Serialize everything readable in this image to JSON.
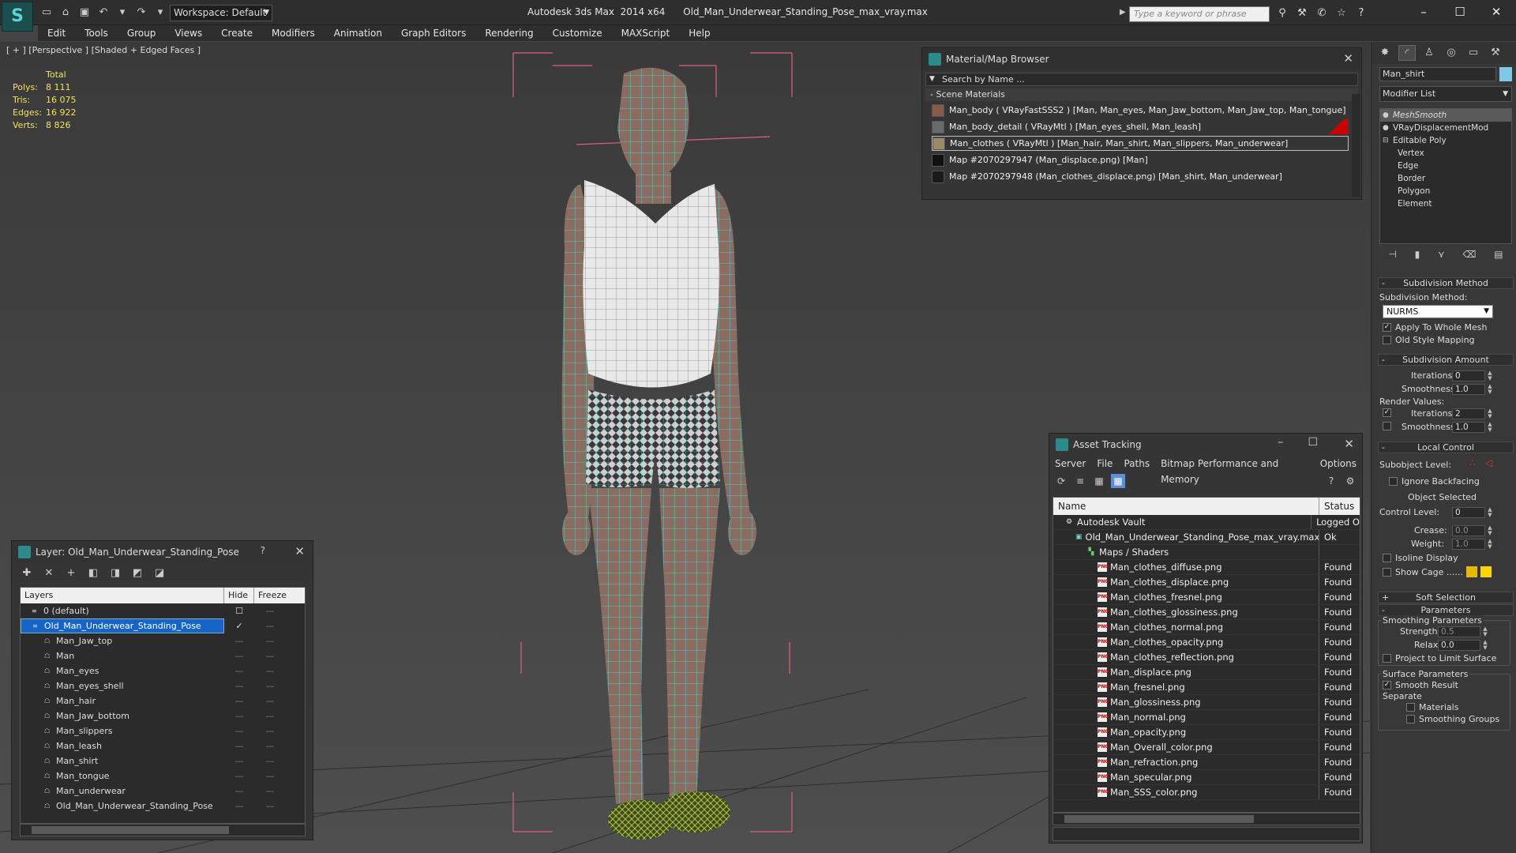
{
  "titlebar": {
    "workspace": "Workspace: Default",
    "title": "Autodesk 3ds Max  2014 x64      Old_Man_Underwear_Standing_Pose_max_vray.max",
    "search_placeholder": "Type a keyword or phrase"
  },
  "menu": [
    "Edit",
    "Tools",
    "Group",
    "Views",
    "Create",
    "Modifiers",
    "Animation",
    "Graph Editors",
    "Rendering",
    "Customize",
    "MAXScript",
    "Help"
  ],
  "viewport": {
    "label": "[ + ] [Perspective ] [Shaded + Edged Faces ]",
    "stats": {
      "header": "Total",
      "rows": [
        {
          "k": "Polys:",
          "v": "8 111"
        },
        {
          "k": "Tris:",
          "v": "16 075"
        },
        {
          "k": "Edges:",
          "v": "16 922"
        },
        {
          "k": "Verts:",
          "v": "8 826"
        }
      ]
    }
  },
  "material_browser": {
    "title": "Material/Map Browser",
    "search": "Search by Name ...",
    "section": "- Scene Materials",
    "items": [
      {
        "label": "Man_body  ( VRayFastSSS2 ) [Man, Man_eyes, Man_Jaw_bottom, Man_Jaw_top, Man_tongue]",
        "swatch": "#8a5a48"
      },
      {
        "label": "Man_body_detail  ( VRayMtl ) [Man_eyes_shell, Man_leash]",
        "swatch": "#6a6a6a"
      },
      {
        "label": "Man_clothes  ( VRayMtl ) [Man_hair, Man_shirt, Man_slippers, Man_underwear]",
        "swatch": "#9a8a6a"
      },
      {
        "label": "Map #2070297947 (Man_displace.png)  [Man]",
        "swatch": "#111111"
      },
      {
        "label": "Map #2070297948 (Man_clothes_displace.png)  [Man_shirt, Man_underwear]",
        "swatch": "#1a1a1a"
      }
    ]
  },
  "asset_tracking": {
    "title": "Asset Tracking",
    "menu": [
      "Server",
      "File",
      "Paths",
      "Bitmap Performance and Memory",
      "Options"
    ],
    "columns": {
      "name": "Name",
      "status": "Status"
    },
    "rows": [
      {
        "name": "Autodesk Vault",
        "status": "Logged O",
        "indent": 1,
        "icon": "vault"
      },
      {
        "name": "Old_Man_Underwear_Standing_Pose_max_vray.max",
        "status": "Ok",
        "indent": 2,
        "icon": "max"
      },
      {
        "name": "Maps / Shaders",
        "status": "",
        "indent": 3,
        "icon": "folder"
      },
      {
        "name": "Man_clothes_diffuse.png",
        "status": "Found",
        "indent": 4,
        "icon": "png"
      },
      {
        "name": "Man_clothes_displace.png",
        "status": "Found",
        "indent": 4,
        "icon": "png"
      },
      {
        "name": "Man_clothes_fresnel.png",
        "status": "Found",
        "indent": 4,
        "icon": "png"
      },
      {
        "name": "Man_clothes_glossiness.png",
        "status": "Found",
        "indent": 4,
        "icon": "png"
      },
      {
        "name": "Man_clothes_normal.png",
        "status": "Found",
        "indent": 4,
        "icon": "png"
      },
      {
        "name": "Man_clothes_opacity.png",
        "status": "Found",
        "indent": 4,
        "icon": "png"
      },
      {
        "name": "Man_clothes_reflection.png",
        "status": "Found",
        "indent": 4,
        "icon": "png"
      },
      {
        "name": "Man_displace.png",
        "status": "Found",
        "indent": 4,
        "icon": "png"
      },
      {
        "name": "Man_fresnel.png",
        "status": "Found",
        "indent": 4,
        "icon": "png"
      },
      {
        "name": "Man_glossiness.png",
        "status": "Found",
        "indent": 4,
        "icon": "png"
      },
      {
        "name": "Man_normal.png",
        "status": "Found",
        "indent": 4,
        "icon": "png"
      },
      {
        "name": "Man_opacity.png",
        "status": "Found",
        "indent": 4,
        "icon": "png"
      },
      {
        "name": "Man_Overall_color.png",
        "status": "Found",
        "indent": 4,
        "icon": "png"
      },
      {
        "name": "Man_refraction.png",
        "status": "Found",
        "indent": 4,
        "icon": "png"
      },
      {
        "name": "Man_specular.png",
        "status": "Found",
        "indent": 4,
        "icon": "png"
      },
      {
        "name": "Man_SSS_color.png",
        "status": "Found",
        "indent": 4,
        "icon": "png"
      }
    ]
  },
  "layers_panel": {
    "title": "Layer: Old_Man_Underwear_Standing_Pose",
    "help": "?",
    "columns": {
      "layers": "Layers",
      "hide": "Hide",
      "freeze": "Freeze"
    },
    "rows": [
      {
        "name": "0 (default)",
        "indent": 1,
        "type": "layer",
        "selected": false
      },
      {
        "name": "Old_Man_Underwear_Standing_Pose",
        "indent": 1,
        "type": "layer",
        "selected": true
      },
      {
        "name": "Man_Jaw_top",
        "indent": 2,
        "type": "obj",
        "selected": false
      },
      {
        "name": "Man",
        "indent": 2,
        "type": "obj",
        "selected": false
      },
      {
        "name": "Man_eyes",
        "indent": 2,
        "type": "obj",
        "selected": false
      },
      {
        "name": "Man_eyes_shell",
        "indent": 2,
        "type": "obj",
        "selected": false
      },
      {
        "name": "Man_hair",
        "indent": 2,
        "type": "obj",
        "selected": false
      },
      {
        "name": "Man_Jaw_bottom",
        "indent": 2,
        "type": "obj",
        "selected": false
      },
      {
        "name": "Man_slippers",
        "indent": 2,
        "type": "obj",
        "selected": false
      },
      {
        "name": "Man_leash",
        "indent": 2,
        "type": "obj",
        "selected": false
      },
      {
        "name": "Man_shirt",
        "indent": 2,
        "type": "obj",
        "selected": false
      },
      {
        "name": "Man_tongue",
        "indent": 2,
        "type": "obj",
        "selected": false
      },
      {
        "name": "Man_underwear",
        "indent": 2,
        "type": "obj",
        "selected": false
      },
      {
        "name": "Old_Man_Underwear_Standing_Pose",
        "indent": 2,
        "type": "obj",
        "selected": false
      }
    ]
  },
  "command_panel": {
    "object_name": "Man_shirt",
    "object_color": "#7ec8e8",
    "modifier_list": "Modifier List",
    "stack": [
      "MeshSmooth",
      "VRayDisplacementMod",
      "Editable Poly",
      "Vertex",
      "Edge",
      "Border",
      "Polygon",
      "Element"
    ],
    "subdivision_method": {
      "rollout": "Subdivision Method",
      "label": "Subdivision Method:",
      "value": "NURMS",
      "apply_whole_mesh": "Apply To Whole Mesh",
      "old_style": "Old Style Mapping"
    },
    "subdivision_amount": {
      "rollout": "Subdivision Amount",
      "iterations_label": "Iterations:",
      "iterations": "0",
      "smoothness_label": "Smoothness:",
      "smoothness": "1.0",
      "render_values": "Render Values:",
      "r_iterations": "2",
      "r_smoothness": "1.0"
    },
    "local_control": {
      "rollout": "Local Control",
      "subobject_level": "Subobject Level:",
      "ignore_backfacing": "Ignore Backfacing",
      "object_selected": "Object Selected",
      "control_level_label": "Control Level:",
      "control_level": "0",
      "crease_label": "Crease:",
      "crease": "0.0",
      "weight_label": "Weight:",
      "weight": "1.0",
      "isoline": "Isoline Display",
      "show_cage": "Show Cage ......"
    },
    "soft_selection": "Soft Selection",
    "parameters": {
      "rollout": "Parameters",
      "smoothing_params": "Smoothing Parameters",
      "strength_label": "Strength:",
      "strength": "0.5",
      "relax_label": "Relax:",
      "relax": "0.0",
      "project": "Project to Limit Surface",
      "surface_params": "Surface Parameters",
      "smooth_result": "Smooth Result",
      "separate": "Separate",
      "materials": "Materials",
      "smoothing_groups": "Smoothing Groups"
    }
  },
  "colors": {
    "accent": "#1565c8",
    "stats": "#f2e35a",
    "wire": "#4fd8ef",
    "bbox": "#e0607a",
    "cage_a": "#e8b800",
    "cage_b": "#ffd400"
  }
}
